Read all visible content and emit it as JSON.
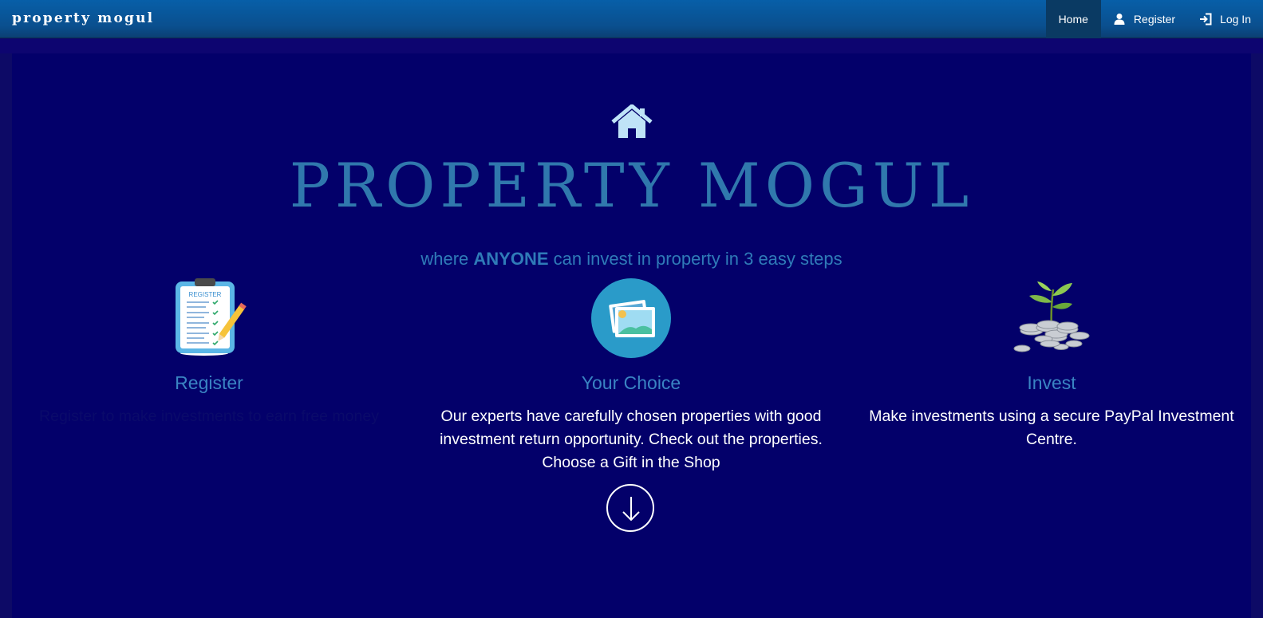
{
  "navbar": {
    "brand": "property mogul",
    "items": [
      {
        "label": "Home",
        "icon": "",
        "active": true
      },
      {
        "label": "Register",
        "icon": "user-icon",
        "active": false
      },
      {
        "label": "Log In",
        "icon": "login-icon",
        "active": false
      }
    ]
  },
  "hero": {
    "icon": "house-icon",
    "title": "PROPERTY MOGUL",
    "subtitle_prefix": "where ",
    "subtitle_emphasis": "ANYONE",
    "subtitle_suffix": " can invest in property in 3 easy steps",
    "steps": [
      {
        "title": "Register",
        "image": "clipboard-register-icon",
        "image_text": "REGISTER",
        "description": "Register to make investments to earn free money"
      },
      {
        "title": "Your Choice",
        "image": "photos-icon",
        "description": "Our experts have carefully chosen properties with good investment return opportunity. Check out the properties. Choose a Gift in the Shop"
      },
      {
        "title": "Invest",
        "image": "coins-plant-icon",
        "description": "Make investments using a secure PayPal Investment Centre."
      }
    ],
    "scroll_icon": "arrow-down-circle-icon"
  },
  "colors": {
    "navbar": "#075fa8",
    "background": "#03006a",
    "title": "#3078ad",
    "accent": "#3a84c3"
  }
}
